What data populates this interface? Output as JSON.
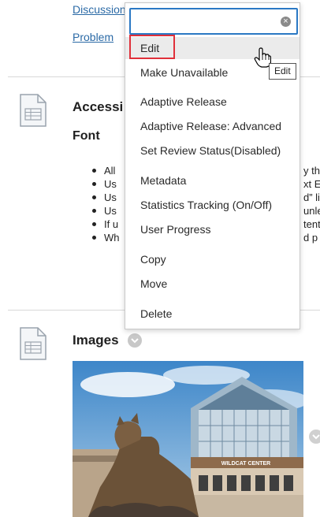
{
  "content": {
    "links": [
      "Discussion",
      "Problem"
    ],
    "items": [
      {
        "title": "Accessi",
        "subheading": "Font",
        "bullets": [
          {
            "left": "All",
            "right": "y the"
          },
          {
            "left": "Us",
            "right": "xt Ec"
          },
          {
            "left": "Us",
            "right": "d” lis"
          },
          {
            "left": "Us",
            "right": "unle"
          },
          {
            "left": "If u",
            "right": "tent"
          },
          {
            "left": "Wh",
            "right": "d p"
          }
        ]
      },
      {
        "title": "Images",
        "photo_sign": "WILDCAT CENTER"
      }
    ]
  },
  "menu": {
    "search_value": "",
    "items": [
      "Edit",
      "Make Unavailable",
      "Adaptive Release",
      "Adaptive Release: Advanced",
      "Set Review Status(Disabled)",
      "Metadata",
      "Statistics Tracking (On/Off)",
      "User Progress",
      "Copy",
      "Move",
      "Delete"
    ]
  },
  "tooltip": "Edit",
  "colors": {
    "link": "#2b6aa6",
    "search_focus": "#2a78c4",
    "highlight_outline": "#e0303a",
    "menu_hover": "#ebebeb"
  },
  "icons": [
    "document-icon",
    "chevron-down-icon",
    "clear-icon",
    "hand-cursor-icon"
  ]
}
